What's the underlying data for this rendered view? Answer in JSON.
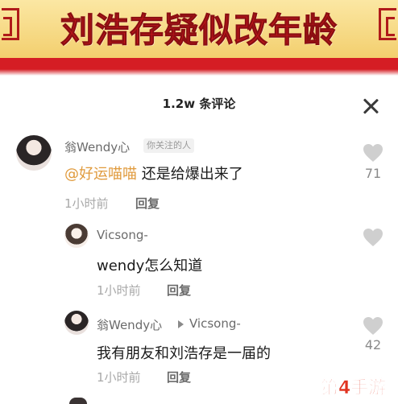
{
  "banner": {
    "headline": "刘浩存疑似改年龄"
  },
  "panel": {
    "title": "1.2w 条评论"
  },
  "comments": [
    {
      "username": "翁Wendy心",
      "badge": "你关注的人",
      "mention": "@好运喵喵",
      "text": " 还是给爆出来了",
      "time": "1小时前",
      "reply_label": "回复",
      "likes": "71"
    },
    {
      "username": "Vicsong-",
      "text": "wendy怎么知道",
      "time": "1小时前",
      "reply_label": "回复",
      "likes": ""
    },
    {
      "username": "翁Wendy心",
      "reply_to": "Vicsong-",
      "text": "我有朋友和刘浩存是一届的",
      "time": "1小时前",
      "reply_label": "回复",
      "likes": "42"
    }
  ],
  "watermark": "第4手游",
  "colors": {
    "banner_red": "#c8161d",
    "banner_gold": "#f3cf6e",
    "mention": "#e09a3c",
    "watermark": "#e0321f"
  }
}
